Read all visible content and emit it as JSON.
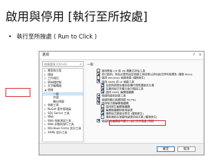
{
  "slide": {
    "title": "啟用與停用 [執行至所按處]",
    "bullet": "執行至所按處 ( Run to Click )"
  },
  "dialog": {
    "title": "選項",
    "window_buttons": [
      "?",
      "×"
    ],
    "search_placeholder": "搜尋選項 (Ctrl+E)",
    "tree": [
      {
        "label": "專案和方案",
        "level": "top",
        "arrow": "▷"
      },
      {
        "label": "環境",
        "level": "top",
        "arrow": "▷"
      },
      {
        "label": "工作項目",
        "level": "top",
        "arrow": "▷"
      },
      {
        "label": "原始檔控制",
        "level": "top",
        "arrow": "▷"
      },
      {
        "label": "文字編輯器",
        "level": "top",
        "arrow": "▷"
      },
      {
        "label": "偵錯",
        "level": "top",
        "arrow": "◢"
      },
      {
        "label": "一般",
        "level": "sub",
        "arrow": "",
        "selected": true
      },
      {
        "label": "符號",
        "level": "sub",
        "arrow": ""
      },
      {
        "label": "輸出視窗",
        "level": "sub",
        "arrow": ""
      },
      {
        "label": "效能工具",
        "level": "top",
        "arrow": "▷"
      },
      {
        "label": "NuGet 套件管理員",
        "level": "top",
        "arrow": "▷"
      },
      {
        "label": "SQL Server 工具",
        "level": "top",
        "arrow": "▷"
      },
      {
        "label": "Web",
        "level": "top",
        "arrow": "▷"
      },
      {
        "label": "Web 效能測試工具",
        "level": "top",
        "arrow": "▷"
      },
      {
        "label": "Web 封裝與發行工具",
        "level": "top",
        "arrow": "▷"
      },
      {
        "label": "Windows Forms 設計工具",
        "level": "top",
        "arrow": "▷"
      },
      {
        "label": "XAML 設計工具",
        "level": "top",
        "arrow": "▷"
      }
    ],
    "section": "一般",
    "options": [
      {
        "label": "使用舊版 C# 和 VB 運算式評估工具",
        "checked": false,
        "level": "l0"
      },
      {
        "label": "若已啟用，則在必要時設定偵錯工具狀態以評估函式呼叫和屬性 (僅限 Mana",
        "checked": true,
        "level": "l0"
      },
      {
        "label": "啟用 Windows 偵錯堆疊 (僅限原生)",
        "checked": false,
        "level": "l0"
      },
      {
        "label": "啟用 XAML 的 UI 偵錯工具",
        "checked": true,
        "level": "l0"
      },
      {
        "label": "在即時視覺化樹狀結構中預覽選取的元素",
        "checked": true,
        "level": "l1"
      },
      {
        "label": "在應用程式中顯示執行階段工具",
        "checked": true,
        "level": "l1"
      },
      {
        "label": "啟用 XAML 編輯後繼續",
        "checked": true,
        "level": "l1"
      },
      {
        "label": "偵錯時啟用診斷工具",
        "checked": true,
        "level": "l0"
      },
      {
        "label": "偵錯時顯示經歷時間 PerfTip",
        "checked": true,
        "level": "l0"
      },
      {
        "label": "啟用程式碼編輯後繼續",
        "checked": true,
        "level": "l0"
      },
      {
        "label": "啟用原生編輯後繼續",
        "checked": false,
        "level": "l1"
      },
      {
        "label": "編輯後繼續時套用變更",
        "checked": true,
        "level": "l1"
      },
      {
        "label": "陳舊程式碼發出警告 (僅限原生)",
        "checked": true,
        "level": "l1"
      },
      {
        "label": "重新連結在偵錯時變更的程式碼 (僅限原生)",
        "checked": false,
        "level": "l1"
      },
      {
        "label": "偵錯時在編輯器中顯示 [執行至所按處] 按鈕",
        "checked": true,
        "level": "l0"
      }
    ],
    "buttons": {
      "ok": "確定",
      "cancel": "取消"
    }
  },
  "colors": {
    "highlight": "#d9262c",
    "selection": "#cce4f7",
    "checkbox_fill": "#1e5fb4"
  }
}
